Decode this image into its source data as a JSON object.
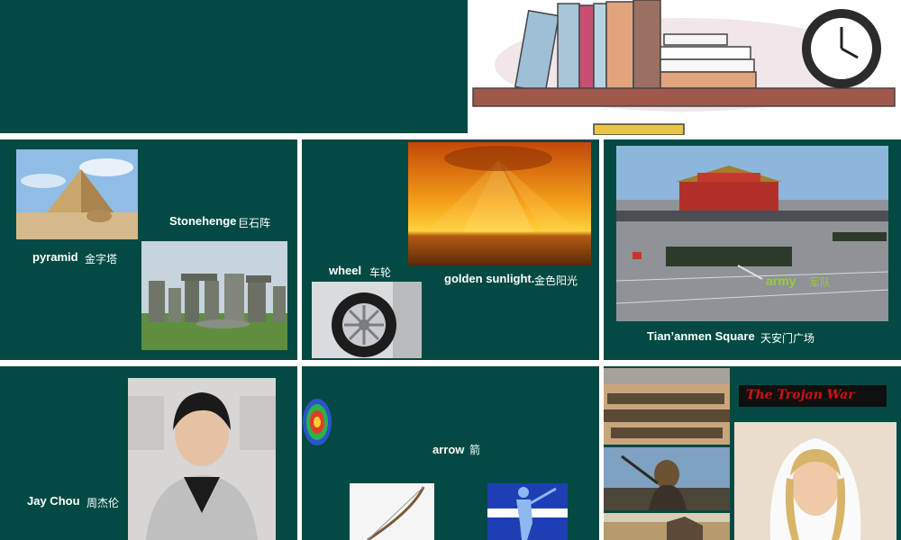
{
  "cells": {
    "pyramid": {
      "en": "pyramid",
      "cn": "金字塔"
    },
    "stonehenge": {
      "en": "Stonehenge",
      "cn": "巨石阵"
    },
    "wheel": {
      "en": "wheel",
      "cn": "车轮"
    },
    "sunlight": {
      "en": "golden sunlight.",
      "cn": "金色阳光"
    },
    "army": {
      "en": "army",
      "cn": "军队"
    },
    "square": {
      "en": "Tian’anmen  Square",
      "cn": "天安门广场"
    },
    "jay": {
      "en": "Jay Chou",
      "cn": "周杰伦"
    },
    "arrow": {
      "en": "arrow",
      "cn": "箭"
    },
    "trojan": {
      "title": "The Trojan War"
    }
  },
  "colors": {
    "panel": "#024a43",
    "label": "#ffffff",
    "army_label": "#9acd32",
    "trojan_title": "#cc1111"
  },
  "icons": [
    "bookshelf-illustration",
    "clock-icon",
    "target-icon",
    "bow-icon",
    "archer-icon"
  ]
}
